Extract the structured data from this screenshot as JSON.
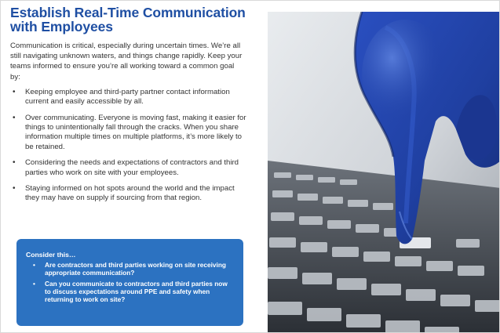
{
  "heading": {
    "line1": "Establish Real-Time Communication",
    "line2": "with Employees"
  },
  "intro": "Communication is critical, especially during uncertain times. We’re all still navigating unknown waters, and things change rapidly. Keep your teams informed to ensure you’re all working toward a common goal by:",
  "bullets": [
    "Keeping employee and third-party partner contact information current and easily accessible by all.",
    "Over communicating. Everyone is moving fast, making it easier for things to unintentionally fall through the cracks. When you share information multiple times on multiple platforms, it’s more likely to be retained.",
    "Considering the needs and expectations of contractors and third parties who work on site with your employees.",
    "Staying informed on hot spots around the world and the impact they may have on supply if sourcing from that region."
  ],
  "bullet_glyph": "•",
  "consider": {
    "heading": "Consider this…",
    "items": [
      "Are contractors and third parties working on site receiving appropriate communication?",
      "Can you communicate to contractors and third parties now to discuss expectations around PPE and safety when returning to work on site?"
    ],
    "bg_color": "#2c72c1"
  },
  "colors": {
    "heading": "#1f4fa3",
    "body_text": "#333333",
    "glove": "#1f3fa0"
  }
}
